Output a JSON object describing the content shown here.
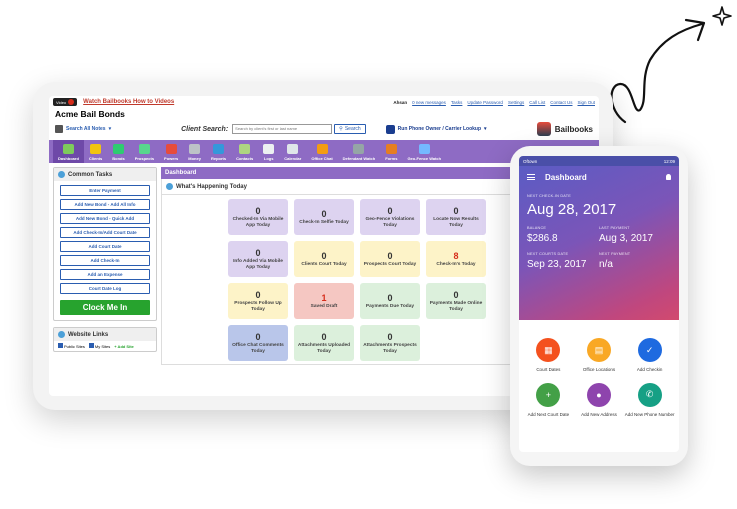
{
  "desktop": {
    "topbar": {
      "video_badge": "Video",
      "watch_link": "Watch Bailbooks How to Videos",
      "user": "Ahsan",
      "new_messages": "0 new messages",
      "tasks": "Tasks",
      "update_password": "Update Password",
      "settings": "Settings",
      "call_list": "Call List",
      "contact_us": "Contact Us",
      "sign_out": "Sign Out"
    },
    "company_name": "Acme Bail Bonds",
    "search_row": {
      "notes_button": "Search All Notes",
      "client_search_label": "Client Search:",
      "client_search_placeholder": "Search by client's first or last name",
      "search_button": "Search",
      "phone_lookup": "Run Phone Owner / Carrier Lookup",
      "brand": "Bailbooks"
    },
    "nav": [
      {
        "label": "Dashboard",
        "color": "#7ecb5b",
        "active": true
      },
      {
        "label": "Clients",
        "color": "#f1c40f"
      },
      {
        "label": "Bonds",
        "color": "#2ecc71"
      },
      {
        "label": "Prospects",
        "color": "#58d68d"
      },
      {
        "label": "Powers",
        "color": "#e74c3c"
      },
      {
        "label": "Money",
        "color": "#bdc3c7"
      },
      {
        "label": "Reports",
        "color": "#3498db"
      },
      {
        "label": "Contacts",
        "color": "#aed581"
      },
      {
        "label": "Logs",
        "color": "#ecf0f1"
      },
      {
        "label": "Calendar",
        "color": "#dfe6e9"
      },
      {
        "label": "Office Chat",
        "color": "#f39c12"
      },
      {
        "label": "Defendant Watch",
        "color": "#95a5a6"
      },
      {
        "label": "Forms",
        "color": "#e67e22"
      },
      {
        "label": "Geo-Fence Watch",
        "color": "#74b9ff"
      }
    ],
    "common_tasks": {
      "title": "Common Tasks",
      "buttons": [
        "Enter Payment",
        "Add New Bond - Add All Info",
        "Add New Bond - Quick Add",
        "Add Check-In/Add Court Date",
        "Add Court Date",
        "Add Check-In",
        "Add an Expense",
        "Court Date Log"
      ],
      "clock_in": "Clock Me In"
    },
    "website_links": {
      "title": "Website Links",
      "public_sites": "Public Sites",
      "my_sites": "My Sites",
      "add_site": "+ Add Site"
    },
    "dashboard_title": "Dashboard",
    "happening_title": "What's Happening Today",
    "tiles": [
      {
        "num": "0",
        "label": "Checked-In Via Mobile App Today",
        "style": "t-purple"
      },
      {
        "num": "0",
        "label": "Check-In Selfie Today",
        "style": "t-purple"
      },
      {
        "num": "0",
        "label": "Geo-Fence Violations Today",
        "style": "t-purple"
      },
      {
        "num": "0",
        "label": "Locate Now Results Today",
        "style": "t-purple"
      },
      {
        "num": "0",
        "label": "Info Added Via Mobile App Today",
        "style": "t-purple"
      },
      {
        "num": "0",
        "label": "Clients Court Today",
        "style": "t-yellow"
      },
      {
        "num": "0",
        "label": "Prospects Court Today",
        "style": "t-yellow"
      },
      {
        "num": "8",
        "label": "Check-In's Today",
        "style": "t-yellow t-red8"
      },
      {
        "num": "0",
        "label": "Prospects Follow Up Today",
        "style": "t-yellow"
      },
      {
        "num": "1",
        "label": "Saved Draft",
        "style": "t-red"
      },
      {
        "num": "0",
        "label": "Payments Due Today",
        "style": "t-green"
      },
      {
        "num": "0",
        "label": "Payments Made Online Today",
        "style": "t-green"
      },
      {
        "num": "0",
        "label": "Office Chat Comments Today",
        "style": "t-blue"
      },
      {
        "num": "0",
        "label": "Attachments Uploaded Today",
        "style": "t-green"
      },
      {
        "num": "0",
        "label": "Attachments Prospects Today",
        "style": "t-green"
      }
    ]
  },
  "mobile": {
    "status_carrier": "Oftown",
    "status_time": "12:09",
    "title": "Dashboard",
    "next_checkin_label": "NEXT CHECK-IN DATE",
    "next_checkin_value": "Aug 28, 2017",
    "balance_label": "BALANCE",
    "balance_value": "$286.8",
    "last_payment_label": "LAST PAYMENT",
    "last_payment_value": "Aug 3, 2017",
    "next_court_label": "NEXT COURTS DATE",
    "next_court_value": "Sep 23, 2017",
    "next_payment_label": "NEXT PAYMENT",
    "next_payment_value": "n/a",
    "actions": [
      {
        "label": "Court Dates",
        "color": "#f4511e",
        "glyph": "▦"
      },
      {
        "label": "Office Locations",
        "color": "#f9a825",
        "glyph": "▤"
      },
      {
        "label": "Add Checkin",
        "color": "#1e6ae0",
        "glyph": "✓"
      },
      {
        "label": "Add Next Court Date",
        "color": "#43a047",
        "glyph": "+"
      },
      {
        "label": "Add New Address",
        "color": "#8e44ad",
        "glyph": "●"
      },
      {
        "label": "Add New Phone Number",
        "color": "#16a085",
        "glyph": "✆"
      }
    ]
  }
}
